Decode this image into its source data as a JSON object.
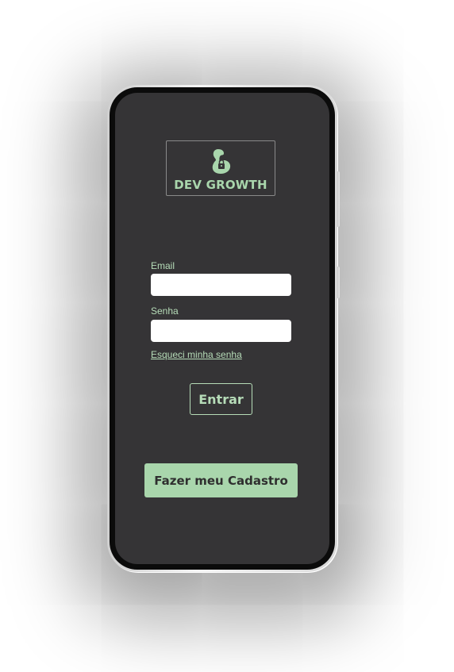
{
  "brand": {
    "name": "DEV GROWTH",
    "icon": "flexed-bicep-lock-icon",
    "accent_color": "#a9d6ac"
  },
  "theme": {
    "screen_background": "#353436",
    "label_color": "#b6dcb8",
    "button_text_color": "#2f2f2f"
  },
  "login_form": {
    "email_label": "Email",
    "email_value": "",
    "email_placeholder": "",
    "password_label": "Senha",
    "password_value": "",
    "password_placeholder": "",
    "forgot_password_link": "Esqueci minha senha",
    "submit_label": "Entrar"
  },
  "signup": {
    "button_label": "Fazer meu Cadastro"
  }
}
